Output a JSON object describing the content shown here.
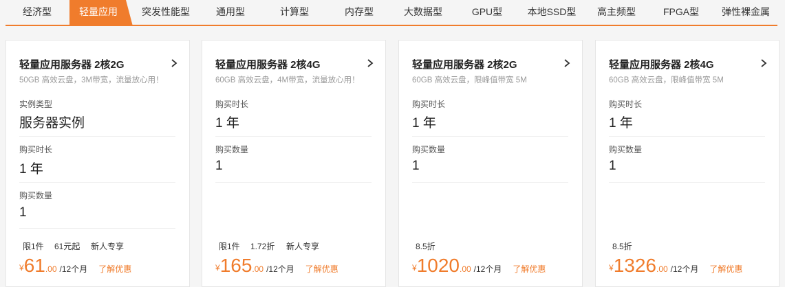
{
  "tabs": [
    {
      "label": "经济型"
    },
    {
      "label": "轻量应用"
    },
    {
      "label": "突发性能型"
    },
    {
      "label": "通用型"
    },
    {
      "label": "计算型"
    },
    {
      "label": "内存型"
    },
    {
      "label": "大数据型"
    },
    {
      "label": "GPU型"
    },
    {
      "label": "本地SSD型"
    },
    {
      "label": "高主频型"
    },
    {
      "label": "FPGA型"
    },
    {
      "label": "弹性裸金属"
    }
  ],
  "active_tab": "轻量应用",
  "accent_color": "#f07c2c",
  "cards": [
    {
      "title": "轻量应用服务器 2核2G",
      "subtitle": "50GB 高效云盘，3M带宽，流量放心用！",
      "fields": [
        {
          "label": "实例类型",
          "value": "服务器实例"
        },
        {
          "label": "购买时长",
          "value": "1 年"
        },
        {
          "label": "购买数量",
          "value": "1"
        }
      ],
      "tags": [
        "限1件",
        "61元起",
        "新人专享"
      ],
      "currency": "¥",
      "price_int": "61",
      "price_dec": ".00",
      "period": "/12个月",
      "promo": "了解优惠"
    },
    {
      "title": "轻量应用服务器 2核4G",
      "subtitle": "60GB 高效云盘，4M带宽，流量放心用！",
      "fields": [
        {
          "label": "购买时长",
          "value": "1 年"
        },
        {
          "label": "购买数量",
          "value": "1"
        }
      ],
      "tags": [
        "限1件",
        "1.72折",
        "新人专享"
      ],
      "currency": "¥",
      "price_int": "165",
      "price_dec": ".00",
      "period": "/12个月",
      "promo": "了解优惠"
    },
    {
      "title": "轻量应用服务器 2核2G",
      "subtitle": "60GB 高效云盘，限峰值带宽 5M",
      "fields": [
        {
          "label": "购买时长",
          "value": "1 年"
        },
        {
          "label": "购买数量",
          "value": "1"
        }
      ],
      "tags": [
        "8.5折"
      ],
      "currency": "¥",
      "price_int": "1020",
      "price_dec": ".00",
      "period": "/12个月",
      "promo": "了解优惠"
    },
    {
      "title": "轻量应用服务器 2核4G",
      "subtitle": "60GB 高效云盘，限峰值带宽 5M",
      "fields": [
        {
          "label": "购买时长",
          "value": "1 年"
        },
        {
          "label": "购买数量",
          "value": "1"
        }
      ],
      "tags": [
        "8.5折"
      ],
      "currency": "¥",
      "price_int": "1326",
      "price_dec": ".00",
      "period": "/12个月",
      "promo": "了解优惠"
    }
  ]
}
